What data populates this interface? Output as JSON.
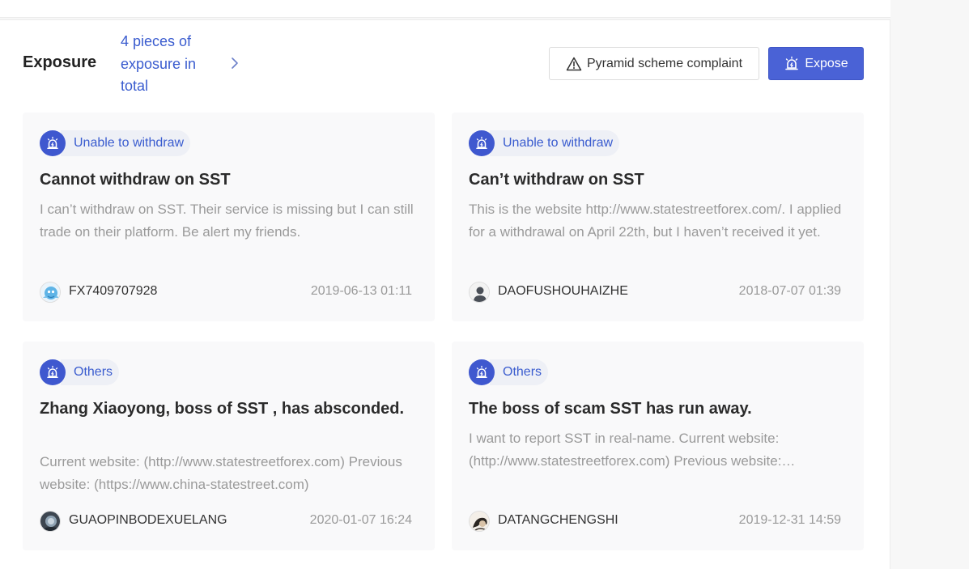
{
  "header": {
    "title": "Exposure",
    "count_link": "4 pieces of exposure in total"
  },
  "actions": {
    "complaint_label": "Pyramid scheme complaint",
    "expose_label": "Expose"
  },
  "colors": {
    "accent": "#4a62d6",
    "link": "#3a5ccf",
    "tag_bg": "#eef0f6",
    "card_bg": "#f9f9fa"
  },
  "cards": [
    {
      "tag": "Unable to withdraw",
      "title": "Cannot withdraw on SST",
      "body": "I can’t withdraw on SST. Their service is missing but I can still trade on their platform. Be alert my friends.",
      "user": "FX7409707928",
      "date": "2019-06-13 01:11"
    },
    {
      "tag": "Unable to withdraw",
      "title": "Can’t withdraw on SST",
      "body": "This is the website http://www.statestreetforex.com/. I applied for a withdrawal on April 22th, but I haven’t received it yet.",
      "user": "DAOFUSHOUHAIZHE",
      "date": "2018-07-07 01:39"
    },
    {
      "tag": "Others",
      "title": "Zhang Xiaoyong, boss of SST , has absconded.",
      "body": "Current website: (http://www.statestreetforex.com) Previous website: (https://www.china-statestreet.com)",
      "user": "GUAOPINBODEXUELANG",
      "date": "2020-01-07 16:24"
    },
    {
      "tag": "Others",
      "title": "The boss of scam SST has run away.",
      "body": "I want to report SST in real-name. Current website: (http://www.statestreetforex.com) Previous website: (https://www.china-statestreet.com)",
      "user": "DATANGCHENGSHI",
      "date": "2019-12-31 14:59"
    }
  ]
}
